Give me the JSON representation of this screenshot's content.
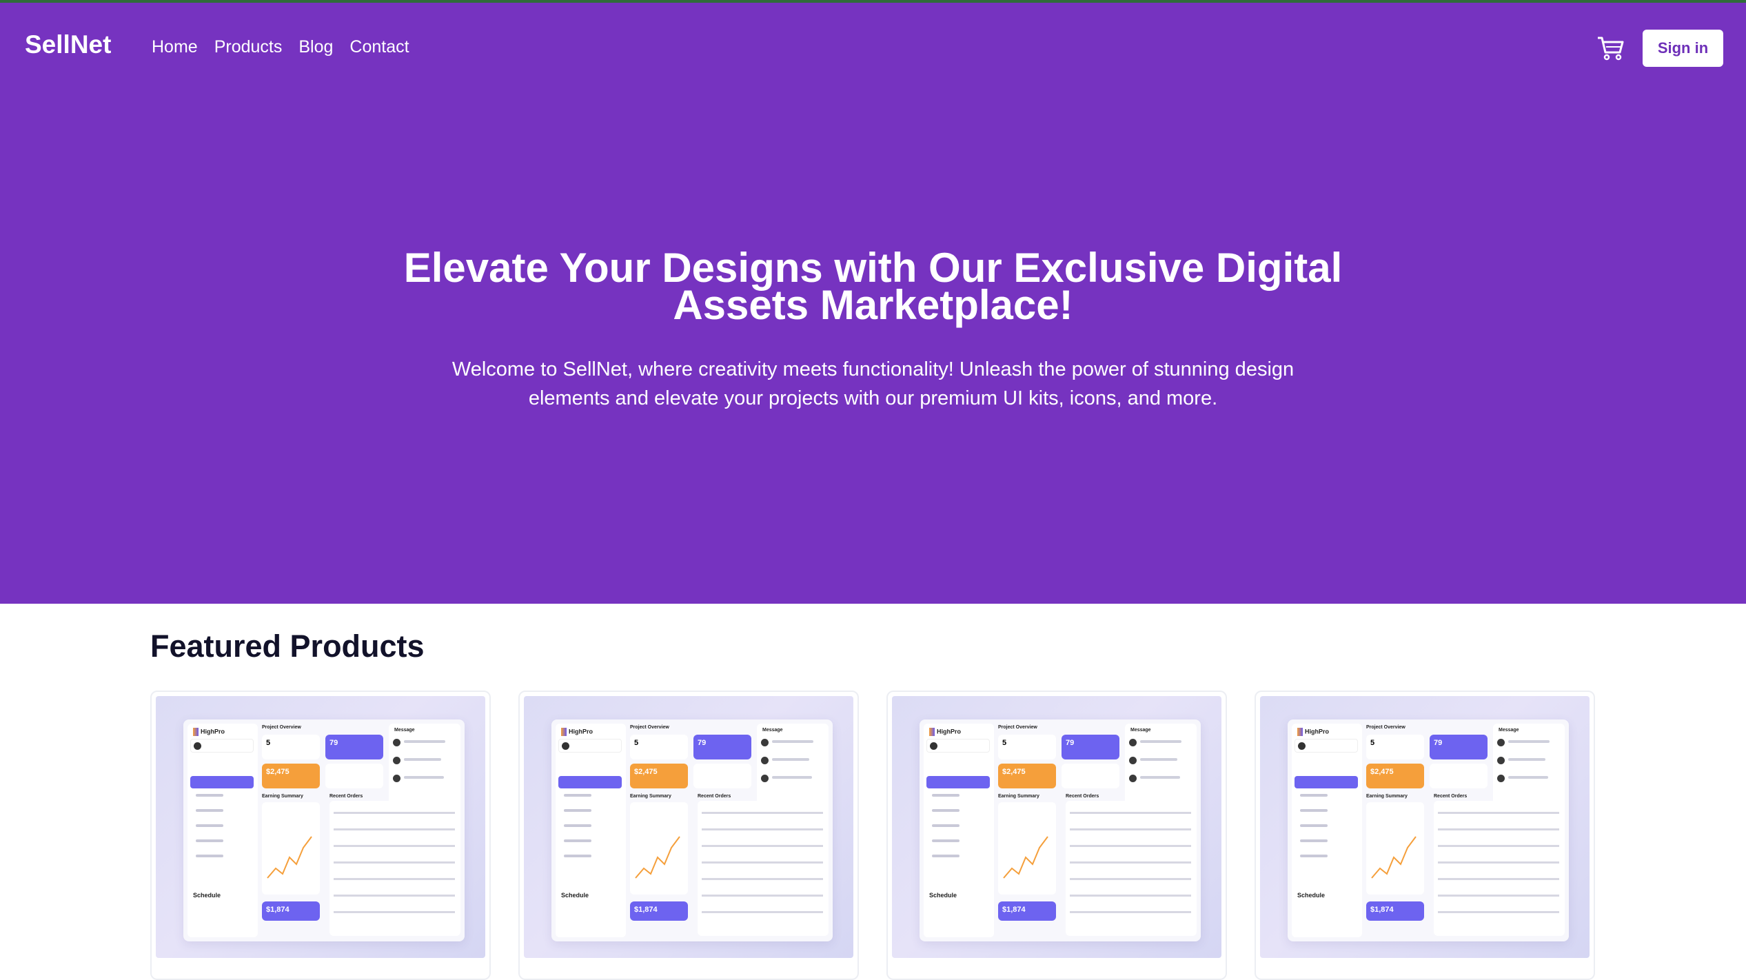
{
  "header": {
    "brand": "SellNet",
    "nav": [
      "Home",
      "Products",
      "Blog",
      "Contact"
    ],
    "cart_icon": "cart-icon",
    "signin_label": "Sign in"
  },
  "hero": {
    "title": "Elevate Your Designs with Our Exclusive Digital Assets Marketplace!",
    "subtitle": "Welcome to SellNet, where creativity meets functionality! Unleash the power of stunning design elements and elevate your projects with our premium UI kits, icons, and more."
  },
  "featured": {
    "title": "Featured Products",
    "cards": [
      {
        "logo": "HighPro",
        "overview": "Project Overview",
        "message": "Message",
        "stat1": "5",
        "stat2": "79",
        "earning": "$2,475",
        "summary": "Earning Summary",
        "orders": "Recent Orders",
        "schedule": "Schedule",
        "bottom": "$1,874"
      },
      {
        "logo": "HighPro",
        "overview": "Project Overview",
        "message": "Message",
        "stat1": "5",
        "stat2": "79",
        "earning": "$2,475",
        "summary": "Earning Summary",
        "orders": "Recent Orders",
        "schedule": "Schedule",
        "bottom": "$1,874"
      },
      {
        "logo": "HighPro",
        "overview": "Project Overview",
        "message": "Message",
        "stat1": "5",
        "stat2": "79",
        "earning": "$2,475",
        "summary": "Earning Summary",
        "orders": "Recent Orders",
        "schedule": "Schedule",
        "bottom": "$1,874"
      },
      {
        "logo": "HighPro",
        "overview": "Project Overview",
        "message": "Message",
        "stat1": "5",
        "stat2": "79",
        "earning": "$2,475",
        "summary": "Earning Summary",
        "orders": "Recent Orders",
        "schedule": "Schedule",
        "bottom": "$1,874"
      }
    ]
  },
  "colors": {
    "accent": "#7633c0",
    "text_dark": "#12122a"
  }
}
